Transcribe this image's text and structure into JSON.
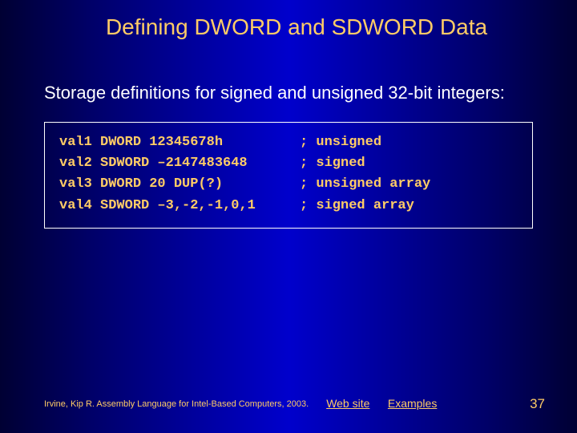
{
  "title": "Defining DWORD and SDWORD Data",
  "subtitle": "Storage definitions for signed and unsigned 32-bit integers:",
  "code": [
    {
      "decl": "val1 DWORD 12345678h",
      "comment": "; unsigned"
    },
    {
      "decl": "val2 SDWORD –2147483648",
      "comment": "; signed"
    },
    {
      "decl": "val3 DWORD 20 DUP(?)",
      "comment": "; unsigned array"
    },
    {
      "decl": "val4 SDWORD –3,-2,-1,0,1",
      "comment": "; signed array"
    }
  ],
  "footer": {
    "citation": "Irvine, Kip R. Assembly Language for Intel-Based Computers, 2003.",
    "link_web": "Web site",
    "link_examples": "Examples",
    "page_number": "37"
  }
}
